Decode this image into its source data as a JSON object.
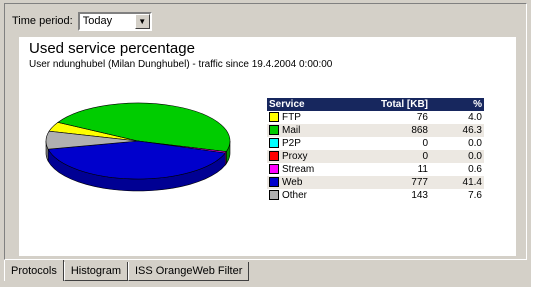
{
  "toolbar": {
    "time_label": "Time period:",
    "time_value": "Today"
  },
  "report": {
    "title": "Used service percentage",
    "subtitle": "User ndunghubel (Milan Dunghubel) - traffic since 19.4.2004 0:00:00"
  },
  "chart_data": {
    "type": "pie",
    "title": "Used service percentage",
    "columns": [
      "Service",
      "Total [KB]",
      "%"
    ],
    "rows": [
      {
        "service": "FTP",
        "total": "76",
        "pct": "4.0",
        "value": 4.0,
        "color": "#ffff00"
      },
      {
        "service": "Mail",
        "total": "868",
        "pct": "46.3",
        "value": 46.3,
        "color": "#00cc00"
      },
      {
        "service": "P2P",
        "total": "0",
        "pct": "0.0",
        "value": 0.0,
        "color": "#00ffff"
      },
      {
        "service": "Proxy",
        "total": "0",
        "pct": "0.0",
        "value": 0.0,
        "color": "#ff0000"
      },
      {
        "service": "Stream",
        "total": "11",
        "pct": "0.6",
        "value": 0.6,
        "color": "#ff00ff"
      },
      {
        "service": "Web",
        "total": "777",
        "pct": "41.4",
        "value": 41.4,
        "color": "#0000cc"
      },
      {
        "service": "Other",
        "total": "143",
        "pct": "7.6",
        "value": 7.6,
        "color": "#b0b0b0"
      }
    ]
  },
  "tabs": [
    {
      "label": "Protocols",
      "active": true
    },
    {
      "label": "Histogram",
      "active": false
    },
    {
      "label": "ISS OrangeWeb Filter",
      "active": false
    }
  ]
}
